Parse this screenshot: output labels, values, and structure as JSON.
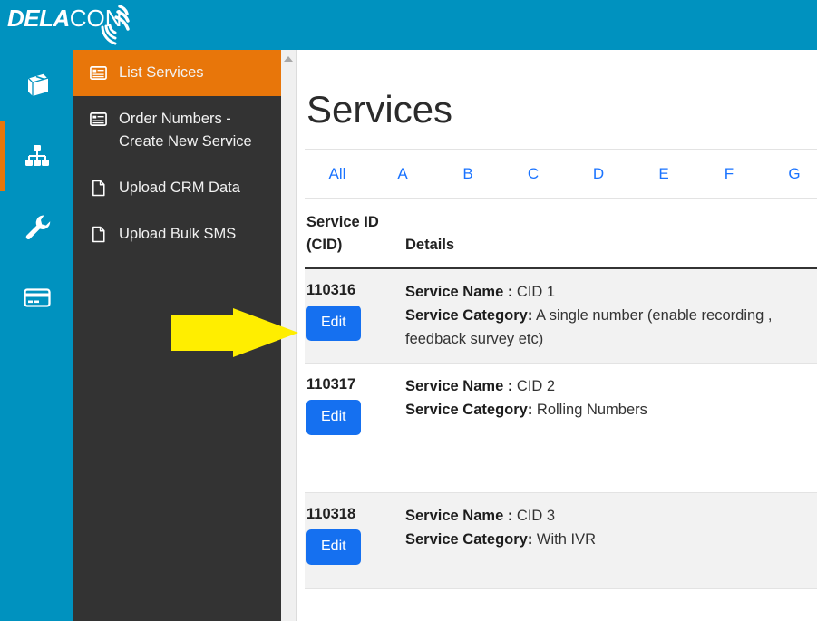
{
  "header": {
    "logo_primary": "DELA",
    "logo_secondary": "CON",
    "logo_icon": "signal-waves-icon",
    "background_color": "#0092bf"
  },
  "rail": {
    "items": [
      {
        "icon": "book-icon",
        "active": false
      },
      {
        "icon": "sitemap-icon",
        "active": true
      },
      {
        "icon": "wrench-icon",
        "active": false
      },
      {
        "icon": "credit-card-icon",
        "active": false
      }
    ],
    "active_color": "#e8760a"
  },
  "sidebar": {
    "items": [
      {
        "label": "List Services",
        "icon": "list-icon",
        "active": true
      },
      {
        "label": "Order Numbers - Create New Service",
        "icon": "list-icon",
        "active": false
      },
      {
        "label": "Upload CRM Data",
        "icon": "file-icon",
        "active": false
      },
      {
        "label": "Upload Bulk SMS",
        "icon": "file-icon",
        "active": false
      }
    ]
  },
  "main": {
    "page_title": "Services",
    "alphabet_filter": [
      "All",
      "A",
      "B",
      "C",
      "D",
      "E",
      "F",
      "G"
    ],
    "table": {
      "columns": {
        "id_line1": "Service ID",
        "id_line2": "(CID)",
        "details": "Details"
      },
      "edit_label": "Edit",
      "labels": {
        "service_name": "Service Name :",
        "service_category": "Service Category:"
      },
      "rows": [
        {
          "cid": "110316",
          "service_name": "CID 1",
          "service_category": "A single number (enable recording , feedback survey etc)"
        },
        {
          "cid": "110317",
          "service_name": "CID 2",
          "service_category": "Rolling Numbers"
        },
        {
          "cid": "110318",
          "service_name": "CID 3",
          "service_category": "With IVR"
        }
      ]
    }
  },
  "annotation": {
    "arrow": "right-arrow-annotation",
    "color": "#ffee00"
  },
  "scrollbar": {
    "up_arrow": "scroll-up-arrow-icon"
  }
}
